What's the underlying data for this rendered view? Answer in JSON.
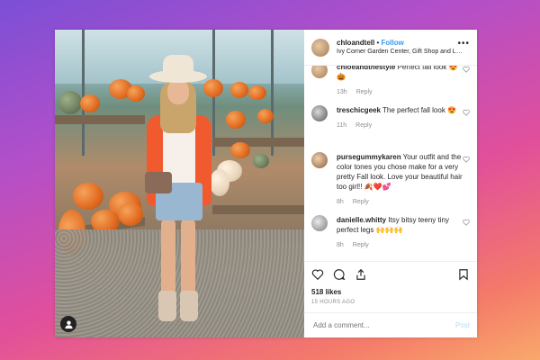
{
  "header": {
    "username": "chloandtell",
    "separator": "•",
    "follow_label": "Follow",
    "location": "Ivy Corner Garden Center, Gift Shop and La...",
    "more_icon": "more-icon"
  },
  "comments": [
    {
      "user": "chloeandthestyle",
      "text": "Perfect fall look 😍🎃",
      "time": "13h",
      "reply": "Reply"
    },
    {
      "user": "treschicgeek",
      "text": "The perfect fall look 😍",
      "time": "11h",
      "reply": "Reply"
    },
    {
      "user": "pursegummykaren",
      "text": "Your outfit and the color tones you chose make for a very pretty Fall look. Love your beautiful hair too girl!! 🍂❤️💕",
      "time": "8h",
      "reply": "Reply"
    },
    {
      "user": "danielle.whitty",
      "text": "Itsy bitsy teeny tiny perfect legs 🙌🙌🙌",
      "time": "8h",
      "reply": "Reply"
    }
  ],
  "actions": {
    "like_icon": "heart-icon",
    "comment_icon": "comment-icon",
    "share_icon": "share-icon",
    "save_icon": "bookmark-icon"
  },
  "likes": "518 likes",
  "time_ago": "15 HOURS AGO",
  "add_comment": {
    "placeholder": "Add a comment...",
    "post_label": "Post"
  },
  "colors": {
    "follow": "#3897f0",
    "post_disabled": "#b2dffc"
  }
}
